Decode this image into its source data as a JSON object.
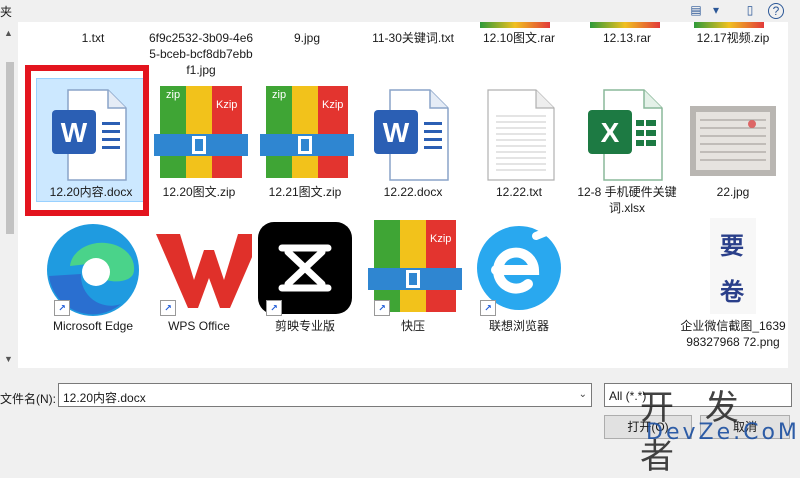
{
  "window": {
    "title_fragment": "夹"
  },
  "row1": [
    {
      "name": "1.txt"
    },
    {
      "name": "6f9c2532-3b09-4e65-bceb-bcf8db7ebbf1.jpg"
    },
    {
      "name": "9.jpg"
    },
    {
      "name": "11-30关键词.txt"
    },
    {
      "name": "12.10图文.rar"
    },
    {
      "name": "12.13.rar"
    },
    {
      "name": "12.17视频.zip"
    }
  ],
  "row2": [
    {
      "name": "12.20内容.docx",
      "icon": "word-document-icon",
      "selected": true
    },
    {
      "name": "12.20图文.zip",
      "icon": "kzip-archive-icon"
    },
    {
      "name": "12.21图文.zip",
      "icon": "kzip-archive-icon"
    },
    {
      "name": "12.22.docx",
      "icon": "word-document-icon"
    },
    {
      "name": "12.22.txt",
      "icon": "text-file-icon"
    },
    {
      "name": "12-8 手机硬件关键词.xlsx",
      "icon": "excel-sheet-icon"
    },
    {
      "name": "22.jpg",
      "icon": "image-thumbnail-icon"
    }
  ],
  "row3": [
    {
      "name": "Microsoft Edge",
      "icon": "edge-browser-icon"
    },
    {
      "name": "WPS Office",
      "icon": "wps-office-icon"
    },
    {
      "name": "剪映专业版",
      "icon": "jianying-icon"
    },
    {
      "name": "快压",
      "icon": "kuaiya-archive-icon"
    },
    {
      "name": "联想浏览器",
      "icon": "lenovo-browser-icon"
    },
    {
      "name": "企业微信截图_163998327968 72.png",
      "icon": "screenshot-thumbnail-icon"
    }
  ],
  "icon_text": {
    "kzip": "Kzip",
    "zip": "zip",
    "word_letter": "W",
    "excel_letter": "X",
    "thumb_text_1": "要",
    "thumb_text_2": "卷"
  },
  "bottom": {
    "filename_label": "文件名(N):",
    "filename_value": "12.20内容.docx",
    "filter_value": "All (*.*)",
    "open_button": "打开(O)",
    "cancel_button": "取消"
  },
  "watermark": {
    "line1": "开 发 者",
    "line2": "DevZe.CoM"
  },
  "colors": {
    "selection": "#cce8ff",
    "highlight": "#e3141e",
    "word": "#2b5fb4",
    "excel": "#1d7a43"
  }
}
